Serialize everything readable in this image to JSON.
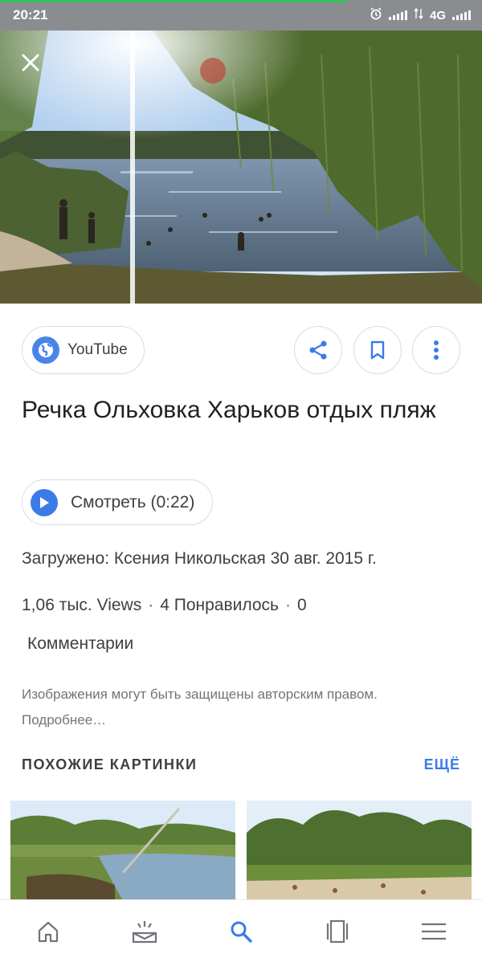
{
  "status_bar": {
    "time": "20:21",
    "network": "4G",
    "page_load_progress": 0.72,
    "icons": [
      "alarm-icon",
      "signal-icon",
      "data-arrows-icon",
      "signal-icon"
    ]
  },
  "viewer": {
    "close_icon": "close-icon",
    "source": {
      "label": "YouTube",
      "icon": "globe-icon"
    },
    "actions": [
      "share-icon",
      "bookmark-icon",
      "more-vert-icon"
    ],
    "title": "Речка Ольховка Харьков отдых пляж",
    "watch_label": "Смотреть (0:22)",
    "uploaded": "Загружено: Ксения Никольская 30 авг. 2015 г.",
    "stats": {
      "views": "1,06 тыс. Views",
      "likes": "4 Понравилось",
      "comments_count": "0",
      "comments_label": "Комментарии",
      "separator": "·"
    },
    "copyright": "Изображения могут быть защищены авторским правом.",
    "copyright_more": "Подробнее…"
  },
  "similar": {
    "header": "ПОХОЖИЕ КАРТИНКИ",
    "more": "ЕЩЁ"
  },
  "bottom_nav": [
    "home-icon",
    "discover-icon",
    "search-icon",
    "tabs-icon",
    "menu-icon"
  ],
  "colors": {
    "accent": "#3b7be8",
    "status_bar": "#8a8d90",
    "progress": "#35c15b",
    "text_primary": "#202124",
    "text_secondary": "#70757a"
  }
}
